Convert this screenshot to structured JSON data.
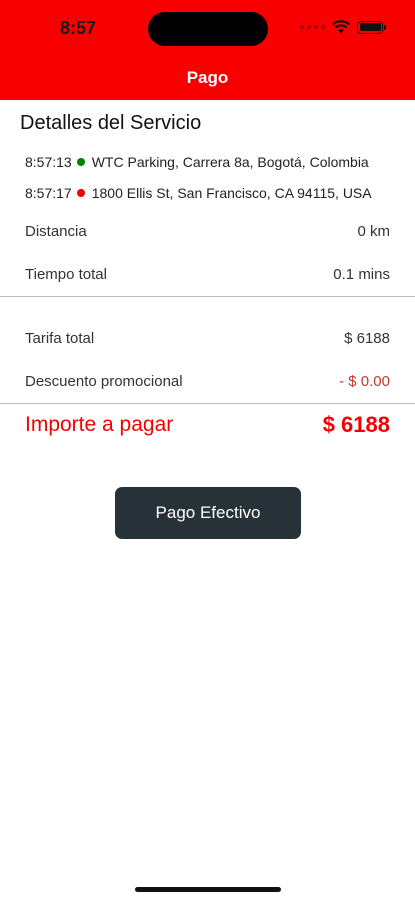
{
  "status_bar": {
    "time": "8:57"
  },
  "header": {
    "title": "Pago"
  },
  "details": {
    "title": "Detalles del Servicio",
    "route": [
      {
        "time": "8:57:13",
        "color": "#008000",
        "address": "WTC Parking, Carrera 8a, Bogotá, Colombia"
      },
      {
        "time": "8:57:17",
        "color": "#f00000",
        "address": "1800 Ellis St, San Francisco, CA 94115, USA"
      }
    ],
    "distance": {
      "label": "Distancia",
      "value": "0 km"
    },
    "total_time": {
      "label": "Tiempo total",
      "value": "0.1 mins"
    }
  },
  "fare": {
    "total": {
      "label": "Tarifa total",
      "value": "$ 6188"
    },
    "discount": {
      "label": "Descuento promocional",
      "value": "- $ 0.00"
    }
  },
  "amount_due": {
    "label": "Importe a pagar",
    "value": "$ 6188"
  },
  "pay_button": {
    "label": "Pago Efectivo"
  },
  "colors": {
    "header": "#f80000",
    "accent_text": "#f50000",
    "button": "#263238"
  }
}
